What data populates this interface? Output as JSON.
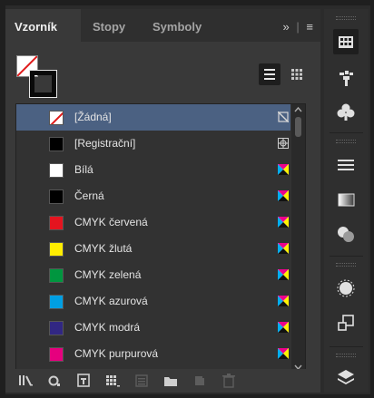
{
  "tabs": [
    {
      "label": "Vzorník",
      "active": true
    },
    {
      "label": "Stopy",
      "active": false
    },
    {
      "label": "Symboly",
      "active": false
    }
  ],
  "tab_overflow": "»",
  "tab_menu": "≡",
  "view_modes": [
    "list-view",
    "grid-view"
  ],
  "swatches": [
    {
      "name": "[Žádná]",
      "color": "none",
      "icon": "no-edit-icon",
      "selected": true
    },
    {
      "name": "[Registrační]",
      "color": "#000000",
      "icon": "registration-icon",
      "selected": false
    },
    {
      "name": "Bílá",
      "color": "#ffffff",
      "icon": "cmyk-icon",
      "selected": false
    },
    {
      "name": "Černá",
      "color": "#000000",
      "icon": "cmyk-icon",
      "selected": false
    },
    {
      "name": "CMYK červená",
      "color": "#e5141f",
      "icon": "cmyk-icon",
      "selected": false
    },
    {
      "name": "CMYK žlutá",
      "color": "#ffed00",
      "icon": "cmyk-icon",
      "selected": false
    },
    {
      "name": "CMYK zelená",
      "color": "#00963f",
      "icon": "cmyk-icon",
      "selected": false
    },
    {
      "name": "CMYK azurová",
      "color": "#009fe3",
      "icon": "cmyk-icon",
      "selected": false
    },
    {
      "name": "CMYK modrá",
      "color": "#312783",
      "icon": "cmyk-icon",
      "selected": false
    },
    {
      "name": "CMYK purpurová",
      "color": "#e6007e",
      "icon": "cmyk-icon",
      "selected": false
    }
  ],
  "colors": {
    "selection": "#4b6182",
    "panel": "#393939",
    "dock": "#2f2f2f"
  }
}
